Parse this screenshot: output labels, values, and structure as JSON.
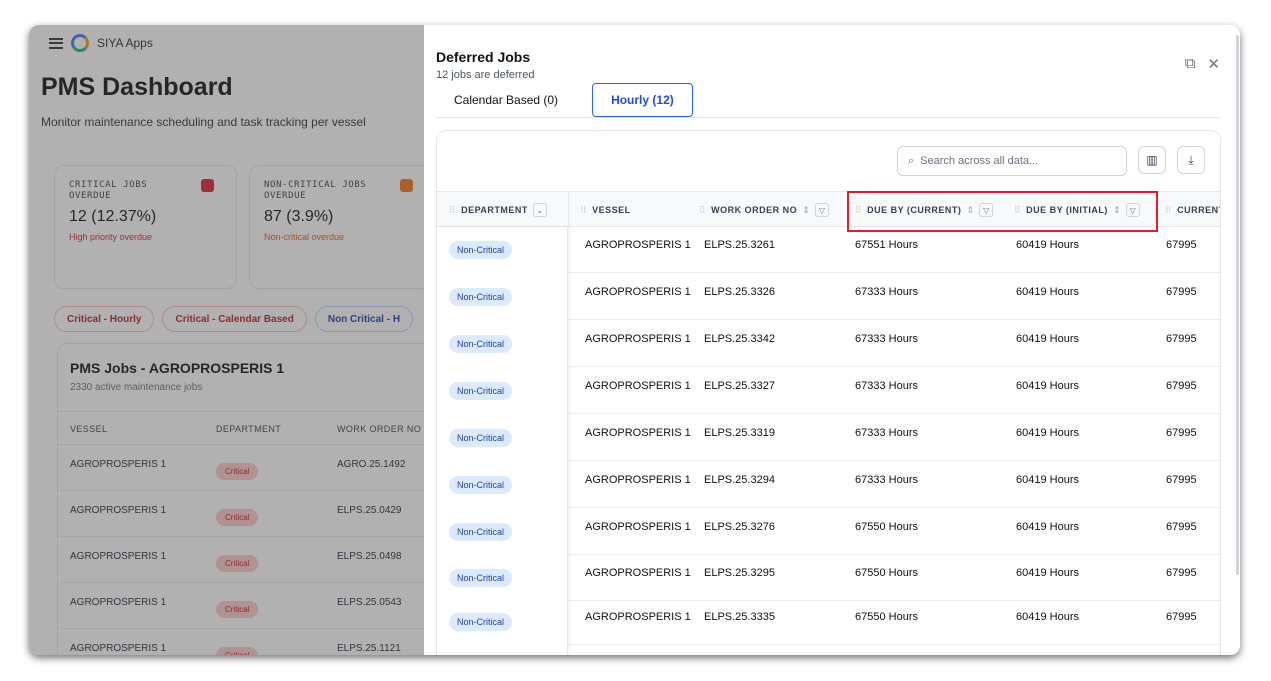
{
  "app": {
    "name": "SIYA Apps"
  },
  "dashboard": {
    "title": "PMS Dashboard",
    "subtitle": "Monitor maintenance scheduling and task tracking per vessel",
    "cards": [
      {
        "label": "CRITICAL JOBS OVERDUE",
        "value": "12 (12.37%)",
        "note": "High priority overdue",
        "accent": "#e11d2f"
      },
      {
        "label": "NON-CRITICAL JOBS OVERDUE",
        "value": "87 (3.9%)",
        "note": "Non-critical overdue",
        "accent": "#f97316"
      }
    ],
    "chips": [
      "Critical - Hourly",
      "Critical - Calendar Based",
      "Non Critical - H"
    ],
    "jobs": {
      "title": "PMS Jobs - AGROPROSPERIS 1",
      "subtitle": "2330 active maintenance jobs",
      "headers": [
        "VESSEL",
        "DEPARTMENT",
        "WORK ORDER NO"
      ],
      "rows": [
        {
          "vessel": "AGROPROSPERIS 1",
          "department": "Critical",
          "wo": "AGRO.25.1492"
        },
        {
          "vessel": "AGROPROSPERIS 1",
          "department": "Critical",
          "wo": "ELPS.25.0429"
        },
        {
          "vessel": "AGROPROSPERIS 1",
          "department": "Critical",
          "wo": "ELPS.25.0498"
        },
        {
          "vessel": "AGROPROSPERIS 1",
          "department": "Critical",
          "wo": "ELPS.25.0543"
        },
        {
          "vessel": "AGROPROSPERIS 1",
          "department": "Critical",
          "wo": "ELPS.25.1121"
        }
      ]
    }
  },
  "drawer": {
    "title": "Deferred Jobs",
    "subtitle": "12 jobs are deferred",
    "tabs": [
      {
        "label": "Calendar Based (0)",
        "active": false
      },
      {
        "label": "Hourly (12)",
        "active": true
      }
    ],
    "search_placeholder": "Search across all data...",
    "columns": [
      "DEPARTMENT",
      "VESSEL",
      "WORK ORDER NO",
      "DUE BY (CURRENT)",
      "DUE BY (INITIAL)",
      "CURRENT C"
    ],
    "rows": [
      {
        "department": "Non-Critical",
        "vessel": "AGROPROSPERIS 1",
        "wo": "ELPS.25.3261",
        "due_current": "67551 Hours",
        "due_initial": "60419 Hours",
        "current": "67995"
      },
      {
        "department": "Non-Critical",
        "vessel": "AGROPROSPERIS 1",
        "wo": "ELPS.25.3326",
        "due_current": "67333 Hours",
        "due_initial": "60419 Hours",
        "current": "67995"
      },
      {
        "department": "Non-Critical",
        "vessel": "AGROPROSPERIS 1",
        "wo": "ELPS.25.3342",
        "due_current": "67333 Hours",
        "due_initial": "60419 Hours",
        "current": "67995"
      },
      {
        "department": "Non-Critical",
        "vessel": "AGROPROSPERIS 1",
        "wo": "ELPS.25.3327",
        "due_current": "67333 Hours",
        "due_initial": "60419 Hours",
        "current": "67995"
      },
      {
        "department": "Non-Critical",
        "vessel": "AGROPROSPERIS 1",
        "wo": "ELPS.25.3319",
        "due_current": "67333 Hours",
        "due_initial": "60419 Hours",
        "current": "67995"
      },
      {
        "department": "Non-Critical",
        "vessel": "AGROPROSPERIS 1",
        "wo": "ELPS.25.3294",
        "due_current": "67333 Hours",
        "due_initial": "60419 Hours",
        "current": "67995"
      },
      {
        "department": "Non-Critical",
        "vessel": "AGROPROSPERIS 1",
        "wo": "ELPS.25.3276",
        "due_current": "67550 Hours",
        "due_initial": "60419 Hours",
        "current": "67995"
      },
      {
        "department": "Non-Critical",
        "vessel": "AGROPROSPERIS 1",
        "wo": "ELPS.25.3295",
        "due_current": "67550 Hours",
        "due_initial": "60419 Hours",
        "current": "67995"
      },
      {
        "department": "Non-Critical",
        "vessel": "AGROPROSPERIS 1",
        "wo": "ELPS.25.3335",
        "due_current": "67550 Hours",
        "due_initial": "60419 Hours",
        "current": "67995"
      }
    ]
  },
  "icons": {
    "open": "external-link-icon",
    "close": "close-icon",
    "columns": "columns-icon",
    "download": "download-icon",
    "search": "search-icon"
  },
  "colors": {
    "accent": "#2563eb",
    "critical": "#e11d2f",
    "highlight": "#e11d2f"
  }
}
